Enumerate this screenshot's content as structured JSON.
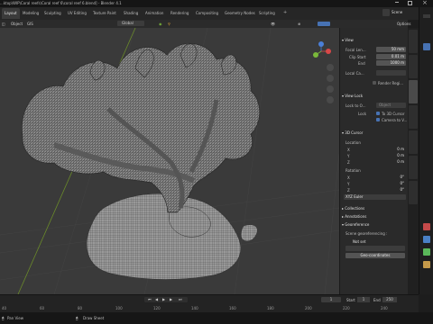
{
  "app": {
    "title": "...ktop\\WIP\\Coral reefs\\Coral reef 6\\coral reef 6.blend] - Blender 4.1",
    "scene_label": "Scene"
  },
  "workspace_tabs": [
    "Layout",
    "Modeling",
    "Sculpting",
    "UV Editing",
    "Texture Paint",
    "Shading",
    "Animation",
    "Rendering",
    "Compositing",
    "Geometry Nodes",
    "Scripting"
  ],
  "header": {
    "object_menu": "Object",
    "gis_menu": "GIS",
    "transform": "Global",
    "options": "Options"
  },
  "npanel": {
    "view_title": "View",
    "focal_label": "Focal Len...",
    "focal_value": "50 mm",
    "clip_start_label": "Clip Start",
    "clip_start_value": "0.01 m",
    "end_label": "End",
    "end_value": "1000 m",
    "local_camera_label": "Local Ca...",
    "render_region_label": "Render Regi...",
    "view_lock_title": "View Lock",
    "lock_to_object_label": "Lock to O...",
    "object_placeholder": "Object",
    "lock_label": "Lock",
    "lock_3d_cursor": "To 3D Cursor",
    "lock_camera": "Camera to V...",
    "cursor_title": "3D Cursor",
    "location_label": "Location",
    "x_label": "X",
    "y_label": "Y",
    "z_label": "Z",
    "loc_x": "0 m",
    "loc_y": "0 m",
    "loc_z": "0 m",
    "rotation_label": "Rotation",
    "rot_x": "0°",
    "rot_y": "0°",
    "rot_z": "0°",
    "rotation_mode": "XYZ Euler",
    "collections": "Collections",
    "annotations": "Annotations",
    "georef_title": "Georeference",
    "scene_georef_label": "Scene georeferencing :",
    "georef_status": "Not set",
    "geo_coords_btn": "Geo-coordinates"
  },
  "vertical_tabs": [
    "Item",
    "Tool",
    "View",
    "Create",
    "Edit",
    "BlenderKit",
    "Node Wrangler"
  ],
  "timeline": {
    "frame": "1",
    "start_label": "Start",
    "start": "1",
    "end_label": "End",
    "end": "250",
    "ticks": [
      "40",
      "60",
      "80",
      "100",
      "120",
      "140",
      "160",
      "180",
      "200",
      "220",
      "240"
    ]
  },
  "status": {
    "pan_view": "Pan View",
    "draw_sheet": "Draw Sheet"
  },
  "colors": {
    "accent": "#4772b3",
    "x_axis": "#d84848",
    "y_axis": "#7ab83a",
    "z_axis": "#4a7fd8",
    "active_frame": "#4772b3"
  }
}
